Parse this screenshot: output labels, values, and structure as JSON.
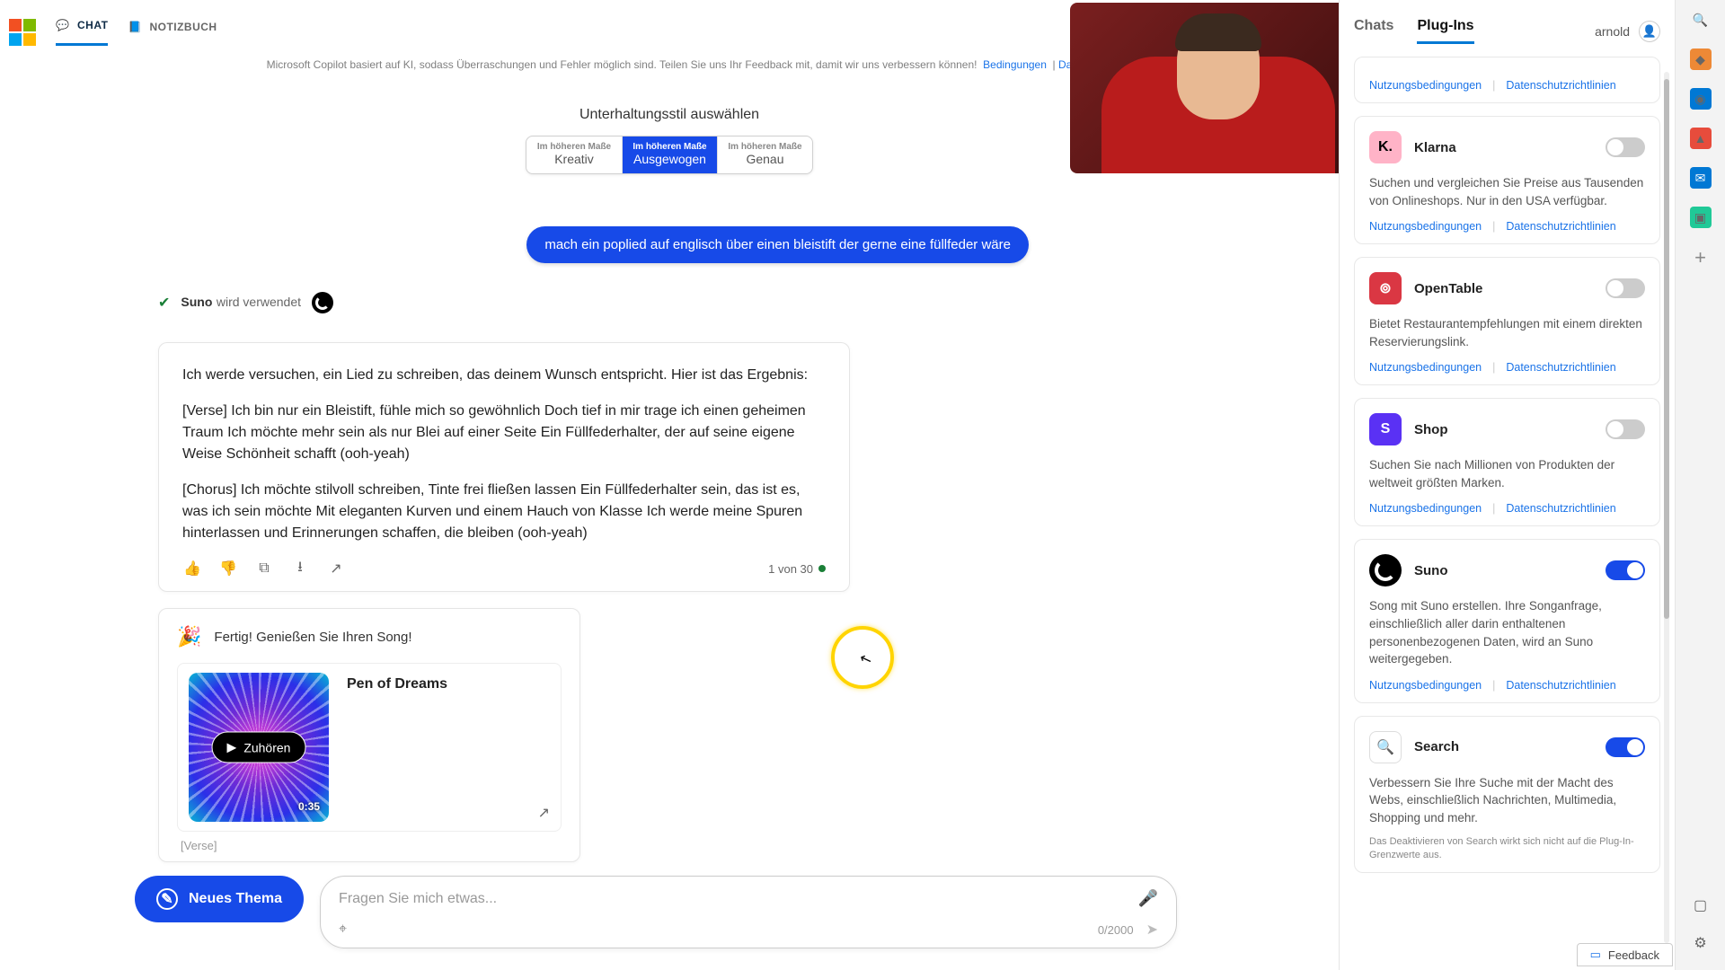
{
  "tabs": {
    "chat": "CHAT",
    "notebook": "NOTIZBUCH"
  },
  "disclaimer": {
    "text": "Microsoft Copilot basiert auf KI, sodass Überraschungen und Fehler möglich sind. Teilen Sie uns Ihr Feedback mit, damit wir uns verbessern können!",
    "terms": "Bedingungen",
    "privacy": "Da"
  },
  "style": {
    "heading": "Unterhaltungsstil auswählen",
    "top": "Im höheren Maße",
    "options": {
      "creative": "Kreativ",
      "balanced": "Ausgewogen",
      "precise": "Genau"
    }
  },
  "user_prompt": "mach ein poplied auf englisch über einen bleistift der gerne eine füllfeder wäre",
  "using": {
    "name": "Suno",
    "suffix": "wird verwendet"
  },
  "ai": {
    "intro": "Ich werde versuchen, ein Lied zu schreiben, das deinem Wunsch entspricht. Hier ist das Ergebnis:",
    "verse": "[Verse] Ich bin nur ein Bleistift, fühle mich so gewöhnlich Doch tief in mir trage ich einen geheimen Traum Ich möchte mehr sein als nur Blei auf einer Seite Ein Füllfederhalter, der auf seine eigene Weise Schönheit schafft (ooh-yeah)",
    "chorus": "[Chorus] Ich möchte stilvoll schreiben, Tinte frei fließen lassen Ein Füllfederhalter sein, das ist es, was ich sein möchte Mit eleganten Kurven und einem Hauch von Klasse Ich werde meine Spuren hinterlassen und Erinnerungen schaffen, die bleiben (ooh-yeah)",
    "counter": "1 von 30"
  },
  "song": {
    "ready": "Fertig! Genießen Sie Ihren Song!",
    "title": "Pen of Dreams",
    "listen": "Zuhören",
    "duration": "0:35",
    "verse_peek": "[Verse]"
  },
  "composer": {
    "new_topic": "Neues Thema",
    "placeholder": "Fragen Sie mich etwas...",
    "count": "0/2000"
  },
  "panel": {
    "tabs": {
      "chats": "Chats",
      "plugins": "Plug-Ins"
    },
    "user": "arnold",
    "links": {
      "terms": "Nutzungsbedingungen",
      "privacy": "Datenschutzrichtlinien"
    },
    "plugins": {
      "klarna": {
        "name": "Klarna",
        "desc": "Suchen und vergleichen Sie Preise aus Tausenden von Onlineshops. Nur in den USA verfügbar."
      },
      "opentable": {
        "name": "OpenTable",
        "desc": "Bietet Restaurantempfehlungen mit einem direkten Reservierungslink."
      },
      "shop": {
        "name": "Shop",
        "desc": "Suchen Sie nach Millionen von Produkten der weltweit größten Marken."
      },
      "suno": {
        "name": "Suno",
        "desc": "Song mit Suno erstellen. Ihre Songanfrage, einschließlich aller darin enthaltenen personenbezogenen Daten, wird an Suno weitergegeben."
      },
      "search": {
        "name": "Search",
        "desc": "Verbessern Sie Ihre Suche mit der Macht des Webs, einschließlich Nachrichten, Multimedia, Shopping und mehr.",
        "note": "Das Deaktivieren von Search wirkt sich nicht auf die Plug-In-Grenzwerte aus."
      }
    }
  },
  "feedback": "Feedback"
}
